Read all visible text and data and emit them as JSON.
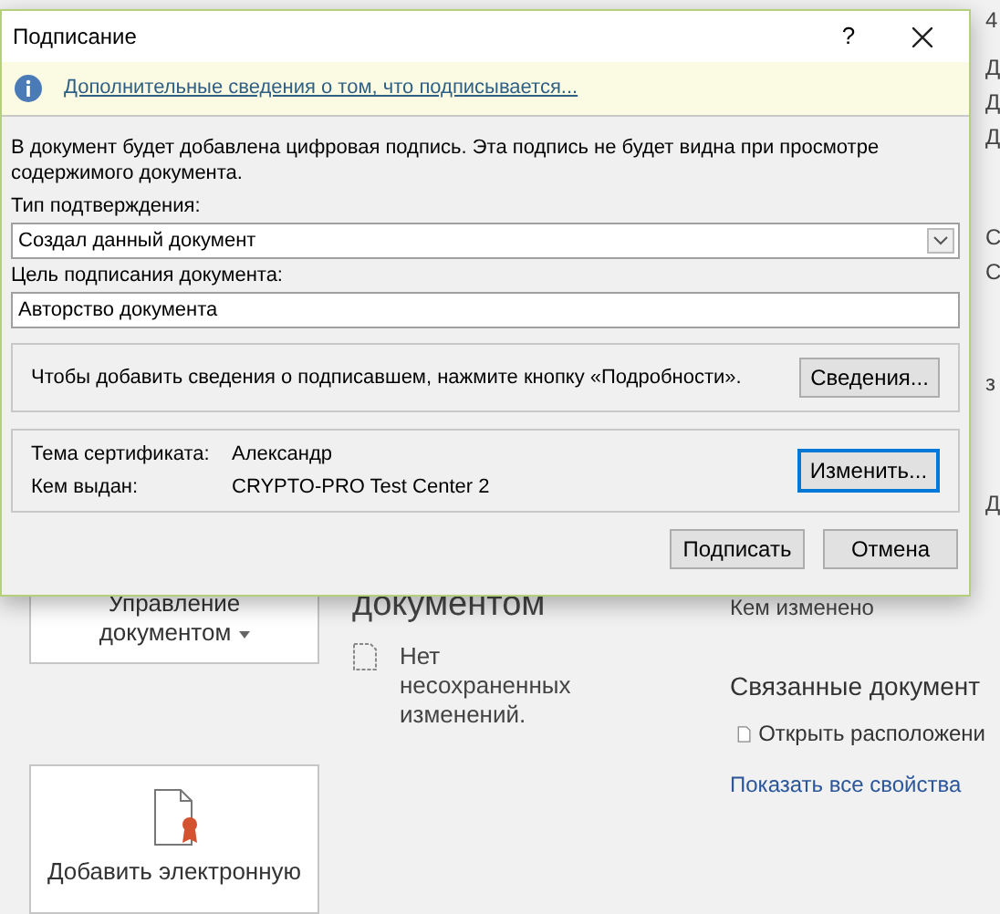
{
  "backstage": {
    "manage_button": {
      "label": "Управление документом"
    },
    "signature_button": {
      "label": "Добавить электронную"
    },
    "section_heading": "документом",
    "unsaved_note": "Нет несохраненных изменений.",
    "modified_by_label": "Кем изменено",
    "related_heading": "Связанные документ",
    "open_location": "Открыть расположени",
    "show_all_link": "Показать все свойства",
    "edge_fragments": [
      "4",
      "Д",
      "Д",
      "Д",
      "С",
      "С",
      "з",
      "Д"
    ]
  },
  "dialog": {
    "title": "Подписание",
    "help": "?",
    "info_link": "Дополнительные сведения о том, что подписывается...",
    "description": "В документ будет добавлена цифровая подпись. Эта подпись не будет видна при просмотре содержимого документа.",
    "commitment_label": "Тип подтверждения:",
    "commitment_value": "Создал данный документ",
    "purpose_label": "Цель подписания документа:",
    "purpose_value": "Авторство документа",
    "signer_note": "Чтобы добавить сведения о подписавшем, нажмите кнопку «Подробности».",
    "details_button": {
      "label": "Сведения...",
      "focused": false
    },
    "certificate": [
      {
        "label": "Тема сертификата:",
        "value": "Александр"
      },
      {
        "label": "Кем выдан:",
        "value": "CRYPTO-PRO Test Center 2"
      }
    ],
    "change_button": {
      "label": "Изменить...",
      "focused": true
    },
    "buttons": [
      {
        "label": "Подписать",
        "focused": false
      },
      {
        "label": "Отмена",
        "focused": false
      }
    ]
  }
}
